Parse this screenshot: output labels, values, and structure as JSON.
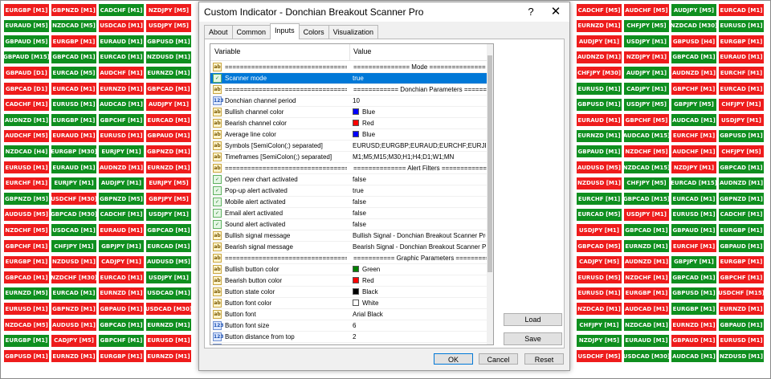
{
  "dialog": {
    "title": "Custom Indicator - Donchian Breakout Scanner Pro",
    "help_label": "?",
    "close_label": "✕",
    "tabs": [
      "About",
      "Common",
      "Inputs",
      "Colors",
      "Visualization"
    ],
    "active_tab": "Inputs",
    "column_variable": "Variable",
    "column_value": "Value",
    "rows": [
      {
        "icon": "ab",
        "variable": "==================================",
        "value": "=============== Mode ===============",
        "sep": true
      },
      {
        "icon": "bool",
        "variable": "Scanner mode",
        "value": "true",
        "selected": true
      },
      {
        "icon": "ab",
        "variable": "==================================",
        "value": "============ Donchian Parameters =========",
        "sep": true
      },
      {
        "icon": "num",
        "variable": "Donchian channel period",
        "value": "10"
      },
      {
        "icon": "ab",
        "variable": "Bullish channel color",
        "value": "Blue",
        "swatch": "#0000ff"
      },
      {
        "icon": "ab",
        "variable": "Bearish channel color",
        "value": "Red",
        "swatch": "#ff0000"
      },
      {
        "icon": "ab",
        "variable": "Average line color",
        "value": "Blue",
        "swatch": "#0000ff"
      },
      {
        "icon": "ab",
        "variable": "Symbols [SemiColon(;) separated]",
        "value": "EURUSD;EURGBP;EURAUD;EURCHF;EURJP..."
      },
      {
        "icon": "ab",
        "variable": "Timeframes [SemiColon(;) separated]",
        "value": "M1;M5;M15;M30;H1;H4;D1;W1;MN"
      },
      {
        "icon": "ab",
        "variable": "==================================",
        "value": "============== Alert Filters =============",
        "sep": true
      },
      {
        "icon": "bool",
        "variable": "Open new chart activated",
        "value": "false"
      },
      {
        "icon": "bool",
        "variable": "Pop-up alert activated",
        "value": "true"
      },
      {
        "icon": "bool",
        "variable": "Mobile alert activated",
        "value": "false"
      },
      {
        "icon": "bool",
        "variable": "Email alert activated",
        "value": "false"
      },
      {
        "icon": "bool",
        "variable": "Sound alert activated",
        "value": "false"
      },
      {
        "icon": "ab",
        "variable": "Bullish signal message",
        "value": "Bullish Signal - Donchian Breakout Scanner Pro"
      },
      {
        "icon": "ab",
        "variable": "Bearish signal message",
        "value": "Bearish Signal - Donchian Breakout Scanner Pro"
      },
      {
        "icon": "ab",
        "variable": "==================================",
        "value": "=========== Graphic Parameters ==========",
        "sep": true
      },
      {
        "icon": "ab",
        "variable": "Bullish button color",
        "value": "Green",
        "swatch": "#008000"
      },
      {
        "icon": "ab",
        "variable": "Bearish button color",
        "value": "Red",
        "swatch": "#ff0000"
      },
      {
        "icon": "ab",
        "variable": "Button state color",
        "value": "Black",
        "swatch": "#000000"
      },
      {
        "icon": "ab",
        "variable": "Button font color",
        "value": "White",
        "swatch": "#ffffff"
      },
      {
        "icon": "ab",
        "variable": "Button font",
        "value": "Arial Black"
      },
      {
        "icon": "num",
        "variable": "Button font size",
        "value": "6"
      },
      {
        "icon": "num",
        "variable": "Button distance from top",
        "value": "2"
      },
      {
        "icon": "num",
        "variable": "Button distance from left",
        "value": "2"
      }
    ],
    "load_label": "Load",
    "save_label": "Save",
    "ok_label": "OK",
    "cancel_label": "Cancel",
    "reset_label": "Reset"
  },
  "tile_colors": {
    "bullish": "#0f8f1f",
    "bearish": "#ee1c1c"
  },
  "left_tiles": [
    [
      [
        "EURGBP [M1]",
        "r"
      ],
      [
        "GBPNZD [M1]",
        "r"
      ],
      [
        "CADCHF [M1]",
        "g"
      ],
      [
        "NZDJPY [M5]",
        "r"
      ]
    ],
    [
      [
        "EURAUD [M5]",
        "g"
      ],
      [
        "NZDCAD [M5]",
        "g"
      ],
      [
        "USDCAD [M1]",
        "r"
      ],
      [
        "USDJPY [M5]",
        "r"
      ]
    ],
    [
      [
        "GBPAUD [M5]",
        "g"
      ],
      [
        "EURGBP [M1]",
        "r"
      ],
      [
        "EURAUD [M1]",
        "g"
      ],
      [
        "GBPUSD [M1]",
        "g"
      ]
    ],
    [
      [
        "GBPAUD [M15]",
        "g"
      ],
      [
        "GBPCAD [M1]",
        "g"
      ],
      [
        "EURCAD [M1]",
        "g"
      ],
      [
        "NZDUSD [M1]",
        "g"
      ]
    ],
    [
      [
        "GBPAUD [D1]",
        "r"
      ],
      [
        "EURCAD [M5]",
        "g"
      ],
      [
        "AUDCHF [M1]",
        "r"
      ],
      [
        "EURNZD [M1]",
        "g"
      ]
    ],
    [
      [
        "GBPCAD [D1]",
        "r"
      ],
      [
        "EURCAD [M1]",
        "r"
      ],
      [
        "EURNZD [M1]",
        "r"
      ],
      [
        "GBPCAD [M1]",
        "r"
      ]
    ],
    [
      [
        "CADCHF [M1]",
        "r"
      ],
      [
        "EURUSD [M1]",
        "g"
      ],
      [
        "AUDCAD [M1]",
        "g"
      ],
      [
        "AUDJPY [M1]",
        "r"
      ]
    ],
    [
      [
        "AUDNZD [M1]",
        "g"
      ],
      [
        "EURGBP [M1]",
        "g"
      ],
      [
        "GBPCHF [M1]",
        "g"
      ],
      [
        "EURCAD [M1]",
        "r"
      ]
    ],
    [
      [
        "AUDCHF [M5]",
        "r"
      ],
      [
        "EURAUD [M1]",
        "r"
      ],
      [
        "EURUSD [M1]",
        "r"
      ],
      [
        "GBPAUD [M1]",
        "r"
      ]
    ],
    [
      [
        "NZDCAD [H4]",
        "g"
      ],
      [
        "EURGBP [M30]",
        "g"
      ],
      [
        "EURJPY [M1]",
        "g"
      ],
      [
        "GBPNZD [M1]",
        "r"
      ]
    ],
    [
      [
        "EURUSD [M1]",
        "r"
      ],
      [
        "EURAUD [M1]",
        "g"
      ],
      [
        "AUDNZD [M1]",
        "r"
      ],
      [
        "EURNZD [M1]",
        "r"
      ]
    ],
    [
      [
        "EURCHF [M1]",
        "r"
      ],
      [
        "EURJPY [M1]",
        "g"
      ],
      [
        "AUDJPY [M1]",
        "g"
      ],
      [
        "EURJPY [M5]",
        "r"
      ]
    ],
    [
      [
        "GBPNZD [M5]",
        "g"
      ],
      [
        "USDCHF [M30]",
        "r"
      ],
      [
        "GBPNZD [M5]",
        "g"
      ],
      [
        "GBPJPY [M5]",
        "r"
      ]
    ],
    [
      [
        "AUDUSD [M5]",
        "r"
      ],
      [
        "GBPCAD [M30]",
        "g"
      ],
      [
        "CADCHF [M1]",
        "g"
      ],
      [
        "USDJPY [M1]",
        "g"
      ]
    ],
    [
      [
        "NZDCHF [M5]",
        "r"
      ],
      [
        "USDCAD [M1]",
        "g"
      ],
      [
        "EURAUD [M1]",
        "r"
      ],
      [
        "GBPCAD [M1]",
        "g"
      ]
    ],
    [
      [
        "GBPCHF [M1]",
        "r"
      ],
      [
        "CHFJPY [M1]",
        "g"
      ],
      [
        "GBPJPY [M1]",
        "g"
      ],
      [
        "EURCAD [M1]",
        "g"
      ]
    ],
    [
      [
        "EURGBP [M1]",
        "r"
      ],
      [
        "NZDUSD [M1]",
        "r"
      ],
      [
        "CADJPY [M1]",
        "r"
      ],
      [
        "AUDUSD [M5]",
        "g"
      ]
    ],
    [
      [
        "GBPCAD [M1]",
        "r"
      ],
      [
        "NZDCHF [M30]",
        "r"
      ],
      [
        "EURCAD [M1]",
        "r"
      ],
      [
        "USDJPY [M1]",
        "g"
      ]
    ],
    [
      [
        "EURNZD [M5]",
        "g"
      ],
      [
        "EURCAD [M1]",
        "g"
      ],
      [
        "EURNZD [M1]",
        "r"
      ],
      [
        "USDCAD [M1]",
        "g"
      ]
    ],
    [
      [
        "EURUSD [M1]",
        "r"
      ],
      [
        "GBPNZD [M1]",
        "r"
      ],
      [
        "GBPAUD [M1]",
        "r"
      ],
      [
        "USDCAD [M30]",
        "r"
      ]
    ],
    [
      [
        "NZDCAD [M5]",
        "r"
      ],
      [
        "AUDUSD [M1]",
        "r"
      ],
      [
        "GBPCAD [M1]",
        "g"
      ],
      [
        "EURNZD [M1]",
        "g"
      ]
    ],
    [
      [
        "EURGBP [M1]",
        "g"
      ],
      [
        "CADJPY [M5]",
        "r"
      ],
      [
        "GBPCHF [M1]",
        "g"
      ],
      [
        "EURUSD [M1]",
        "r"
      ]
    ],
    [
      [
        "GBPUSD [M1]",
        "r"
      ],
      [
        "EURNZD [M1]",
        "r"
      ],
      [
        "EURGBP [M1]",
        "r"
      ],
      [
        "EURNZD [M1]",
        "r"
      ]
    ]
  ],
  "right_tiles": [
    [
      [
        "CADCHF [M5]",
        "r"
      ],
      [
        "AUDCHF [M5]",
        "r"
      ],
      [
        "AUDJPY [M5]",
        "g"
      ],
      [
        "EURCAD [M1]",
        "r"
      ]
    ],
    [
      [
        "EURNZD [M1]",
        "r"
      ],
      [
        "CHFJPY [M5]",
        "g"
      ],
      [
        "NZDCAD [M30]",
        "g"
      ],
      [
        "EURUSD [M1]",
        "g"
      ]
    ],
    [
      [
        "AUDJPY [M1]",
        "r"
      ],
      [
        "USDJPY [M1]",
        "g"
      ],
      [
        "GBPUSD [H4]",
        "r"
      ],
      [
        "EURGBP [M1]",
        "r"
      ]
    ],
    [
      [
        "AUDNZD [M1]",
        "r"
      ],
      [
        "NZDJPY [M1]",
        "r"
      ],
      [
        "GBPCAD [M1]",
        "g"
      ],
      [
        "EURAUD [M1]",
        "r"
      ]
    ],
    [
      [
        "CHFJPY [M30]",
        "r"
      ],
      [
        "AUDJPY [M1]",
        "g"
      ],
      [
        "AUDNZD [M1]",
        "r"
      ],
      [
        "EURCHF [M1]",
        "r"
      ]
    ],
    [
      [
        "EURUSD [M1]",
        "g"
      ],
      [
        "CADJPY [M1]",
        "g"
      ],
      [
        "GBPCHF [M1]",
        "r"
      ],
      [
        "EURCAD [M1]",
        "r"
      ]
    ],
    [
      [
        "GBPUSD [M1]",
        "g"
      ],
      [
        "USDJPY [M5]",
        "g"
      ],
      [
        "GBPJPY [M5]",
        "g"
      ],
      [
        "CHFJPY [M1]",
        "r"
      ]
    ],
    [
      [
        "EURAUD [M1]",
        "r"
      ],
      [
        "GBPCHF [M5]",
        "r"
      ],
      [
        "AUDCAD [M1]",
        "g"
      ],
      [
        "USDJPY [M1]",
        "r"
      ]
    ],
    [
      [
        "EURNZD [M1]",
        "g"
      ],
      [
        "AUDCAD [M15]",
        "g"
      ],
      [
        "EURCHF [M1]",
        "r"
      ],
      [
        "GBPUSD [M1]",
        "g"
      ]
    ],
    [
      [
        "GBPAUD [M1]",
        "g"
      ],
      [
        "NZDCHF [M5]",
        "r"
      ],
      [
        "AUDCHF [M1]",
        "r"
      ],
      [
        "CHFJPY [M5]",
        "r"
      ]
    ],
    [
      [
        "AUDUSD [M5]",
        "r"
      ],
      [
        "NZDCAD [M15]",
        "g"
      ],
      [
        "NZDJPY [M1]",
        "r"
      ],
      [
        "GBPCAD [M1]",
        "g"
      ]
    ],
    [
      [
        "NZDUSD [M1]",
        "r"
      ],
      [
        "CHFJPY [M5]",
        "g"
      ],
      [
        "EURCAD [M15]",
        "g"
      ],
      [
        "AUDNZD [M1]",
        "g"
      ]
    ],
    [
      [
        "EURCHF [M1]",
        "g"
      ],
      [
        "GBPCAD [M15]",
        "g"
      ],
      [
        "EURCAD [M1]",
        "g"
      ],
      [
        "GBPNZD [M1]",
        "g"
      ]
    ],
    [
      [
        "EURCAD [M5]",
        "g"
      ],
      [
        "USDJPY [M1]",
        "r"
      ],
      [
        "EURUSD [M1]",
        "g"
      ],
      [
        "CADCHF [M1]",
        "g"
      ]
    ],
    [
      [
        "USDJPY [M1]",
        "r"
      ],
      [
        "GBPCAD [M1]",
        "g"
      ],
      [
        "GBPAUD [M1]",
        "g"
      ],
      [
        "EURGBP [M1]",
        "g"
      ]
    ],
    [
      [
        "GBPCAD [M5]",
        "r"
      ],
      [
        "EURNZD [M1]",
        "g"
      ],
      [
        "EURCHF [M1]",
        "r"
      ],
      [
        "GBPAUD [M1]",
        "g"
      ]
    ],
    [
      [
        "CADJPY [M5]",
        "r"
      ],
      [
        "AUDNZD [M1]",
        "r"
      ],
      [
        "GBPJPY [M1]",
        "g"
      ],
      [
        "EURGBP [M1]",
        "r"
      ]
    ],
    [
      [
        "EURUSD [M5]",
        "r"
      ],
      [
        "NZDCHF [M1]",
        "r"
      ],
      [
        "GBPCAD [M1]",
        "g"
      ],
      [
        "GBPCHF [M1]",
        "r"
      ]
    ],
    [
      [
        "EURUSD [M1]",
        "r"
      ],
      [
        "EURGBP [M1]",
        "r"
      ],
      [
        "GBPUSD [M1]",
        "g"
      ],
      [
        "USDCHF [M15]",
        "r"
      ]
    ],
    [
      [
        "NZDCAD [M1]",
        "r"
      ],
      [
        "AUDCAD [M1]",
        "r"
      ],
      [
        "EURGBP [M1]",
        "g"
      ],
      [
        "EURNZD [M1]",
        "r"
      ]
    ],
    [
      [
        "CHFJPY [M1]",
        "g"
      ],
      [
        "NZDCAD [M1]",
        "g"
      ],
      [
        "EURNZD [M1]",
        "r"
      ],
      [
        "GBPAUD [M1]",
        "g"
      ]
    ],
    [
      [
        "NZDJPY [M5]",
        "g"
      ],
      [
        "EURAUD [M1]",
        "g"
      ],
      [
        "GBPAUD [M1]",
        "r"
      ],
      [
        "EURUSD [M1]",
        "r"
      ]
    ],
    [
      [
        "USDCHF [M5]",
        "r"
      ],
      [
        "USDCAD [M30]",
        "g"
      ],
      [
        "AUDCAD [M1]",
        "g"
      ],
      [
        "NZDUSD [M1]",
        "g"
      ]
    ]
  ]
}
